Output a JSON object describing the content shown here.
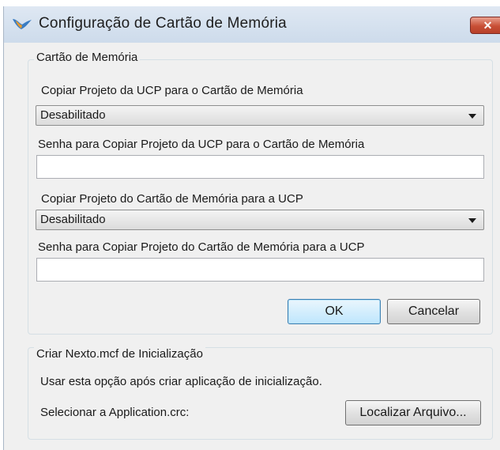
{
  "window": {
    "title": "Configuração de Cartão de Memória",
    "close_label": "✕"
  },
  "memory_card": {
    "group_title": "Cartão de Memória",
    "copy_to_card_label": "Copiar Projeto da UCP para o Cartão de Memória",
    "copy_to_card_value": "Desabilitado",
    "copy_to_card_password_label": "Senha para Copiar Projeto da UCP para o Cartão de Memória",
    "copy_to_card_password_value": "",
    "copy_from_card_label": "Copiar Projeto do Cartão de Memória para a UCP",
    "copy_from_card_value": "Desabilitado",
    "copy_from_card_password_label": "Senha para Copiar Projeto do Cartão de Memória para a UCP",
    "copy_from_card_password_value": "",
    "ok_label": "OK",
    "cancel_label": "Cancelar"
  },
  "init_file": {
    "group_title": "Criar Nexto.mcf de Inicialização",
    "hint": "Usar esta opção após criar aplicação de inicialização.",
    "select_label": "Selecionar a Application.crc:",
    "browse_label": "Localizar Arquivo..."
  },
  "icons": {
    "app": "bird-logo-icon",
    "dropdown": "chevron-down-icon"
  }
}
